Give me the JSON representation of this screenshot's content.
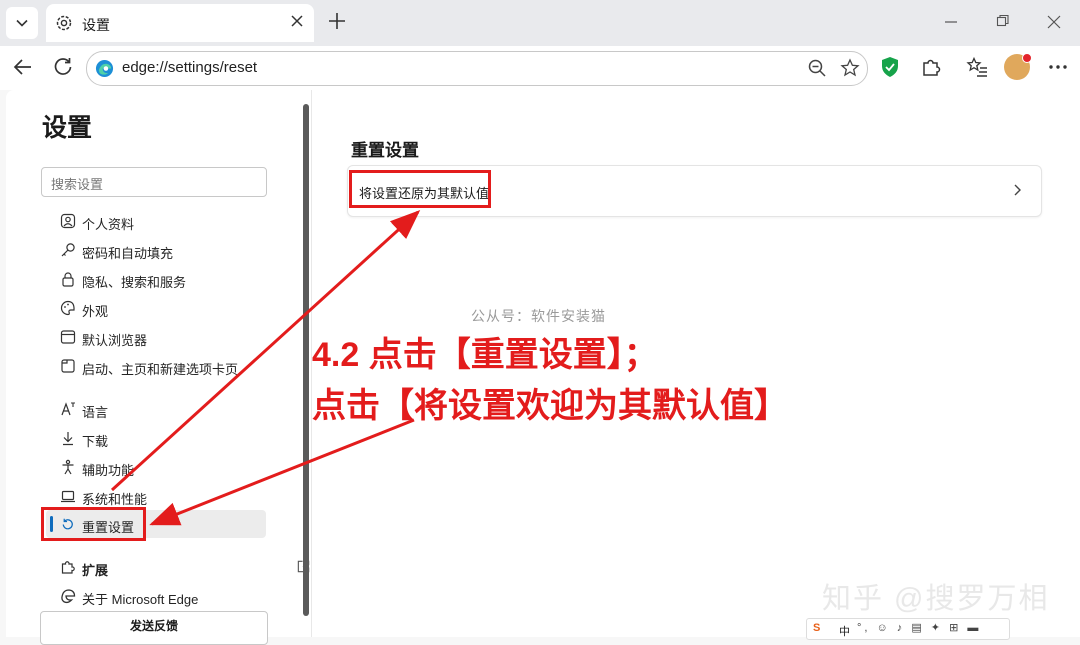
{
  "tab": {
    "title": "设置"
  },
  "address": {
    "url": "edge://settings/reset"
  },
  "sidebar": {
    "title": "设置",
    "search_placeholder": "搜索设置",
    "items": [
      {
        "label": "个人资料",
        "icon": "profile-icon"
      },
      {
        "label": "密码和自动填充",
        "icon": "key-icon"
      },
      {
        "label": "隐私、搜索和服务",
        "icon": "lock-icon"
      },
      {
        "label": "外观",
        "icon": "palette-icon"
      },
      {
        "label": "默认浏览器",
        "icon": "browser-icon"
      },
      {
        "label": "启动、主页和新建选项卡页",
        "icon": "home-icon"
      },
      {
        "label": "语言",
        "icon": "language-icon"
      },
      {
        "label": "下载",
        "icon": "download-icon"
      },
      {
        "label": "辅助功能",
        "icon": "accessibility-icon"
      },
      {
        "label": "系统和性能",
        "icon": "laptop-icon"
      },
      {
        "label": "重置设置",
        "icon": "reset-icon",
        "active": true
      },
      {
        "label": "扩展",
        "icon": "puzzle-icon"
      },
      {
        "label": "关于 Microsoft Edge",
        "icon": "edge-icon"
      }
    ],
    "feedback_label": "发送反馈"
  },
  "main": {
    "section_title": "重置设置",
    "card_label": "将设置还原为其默认值"
  },
  "overlay": {
    "watermark": "公从号：软件安装猫",
    "annotation_line1": "4.2 点击【重置设置】；",
    "annotation_line2": "点击【将设置欢迎为其默认值】",
    "zhihu_watermark": "知乎 @搜罗万相",
    "ime_s": "S",
    "ime_lang": "中",
    "annotation_color": "#e31c1c"
  },
  "colors": {
    "accent": "#0f6cbd",
    "highlight": "#e31c1c"
  }
}
